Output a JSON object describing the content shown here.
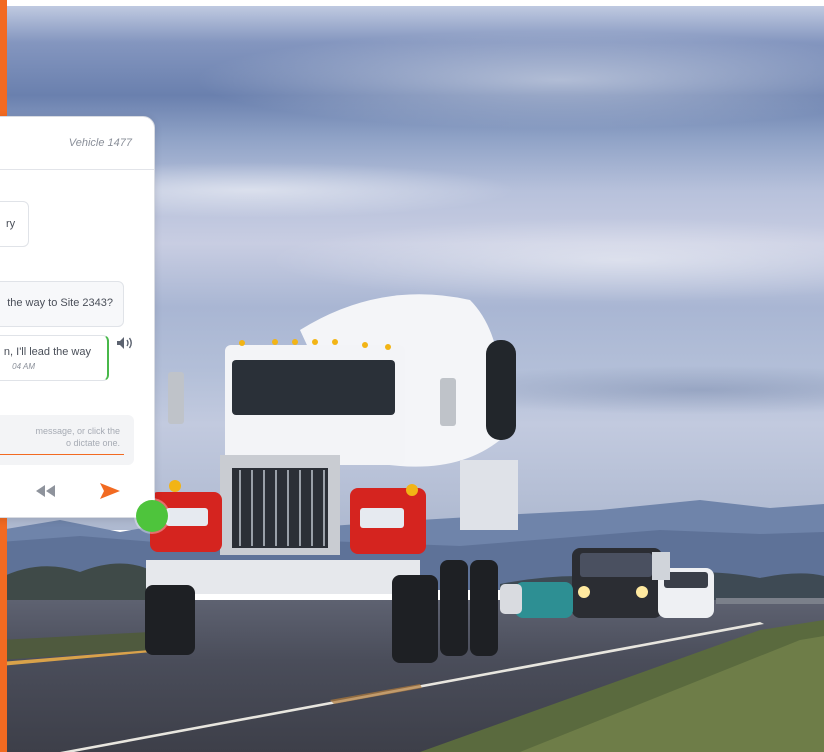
{
  "chat": {
    "vehicle": "Vehicle 1477",
    "messages": [
      {
        "text": "ry"
      },
      {
        "text": "the way to Site 2343?"
      },
      {
        "text": "n, I'll lead the way",
        "time": "04 AM"
      }
    ],
    "input_placeholder_line1": "message, or click the",
    "input_placeholder_line2": "o dictate one.",
    "icons": [
      "speaker-icon",
      "rewind-icon",
      "send-icon",
      "microphone-button"
    ]
  },
  "colors": {
    "accent": "#f26a21",
    "active": "#4ec43c",
    "text": "#4a4f59",
    "muted": "#8a8f99"
  }
}
